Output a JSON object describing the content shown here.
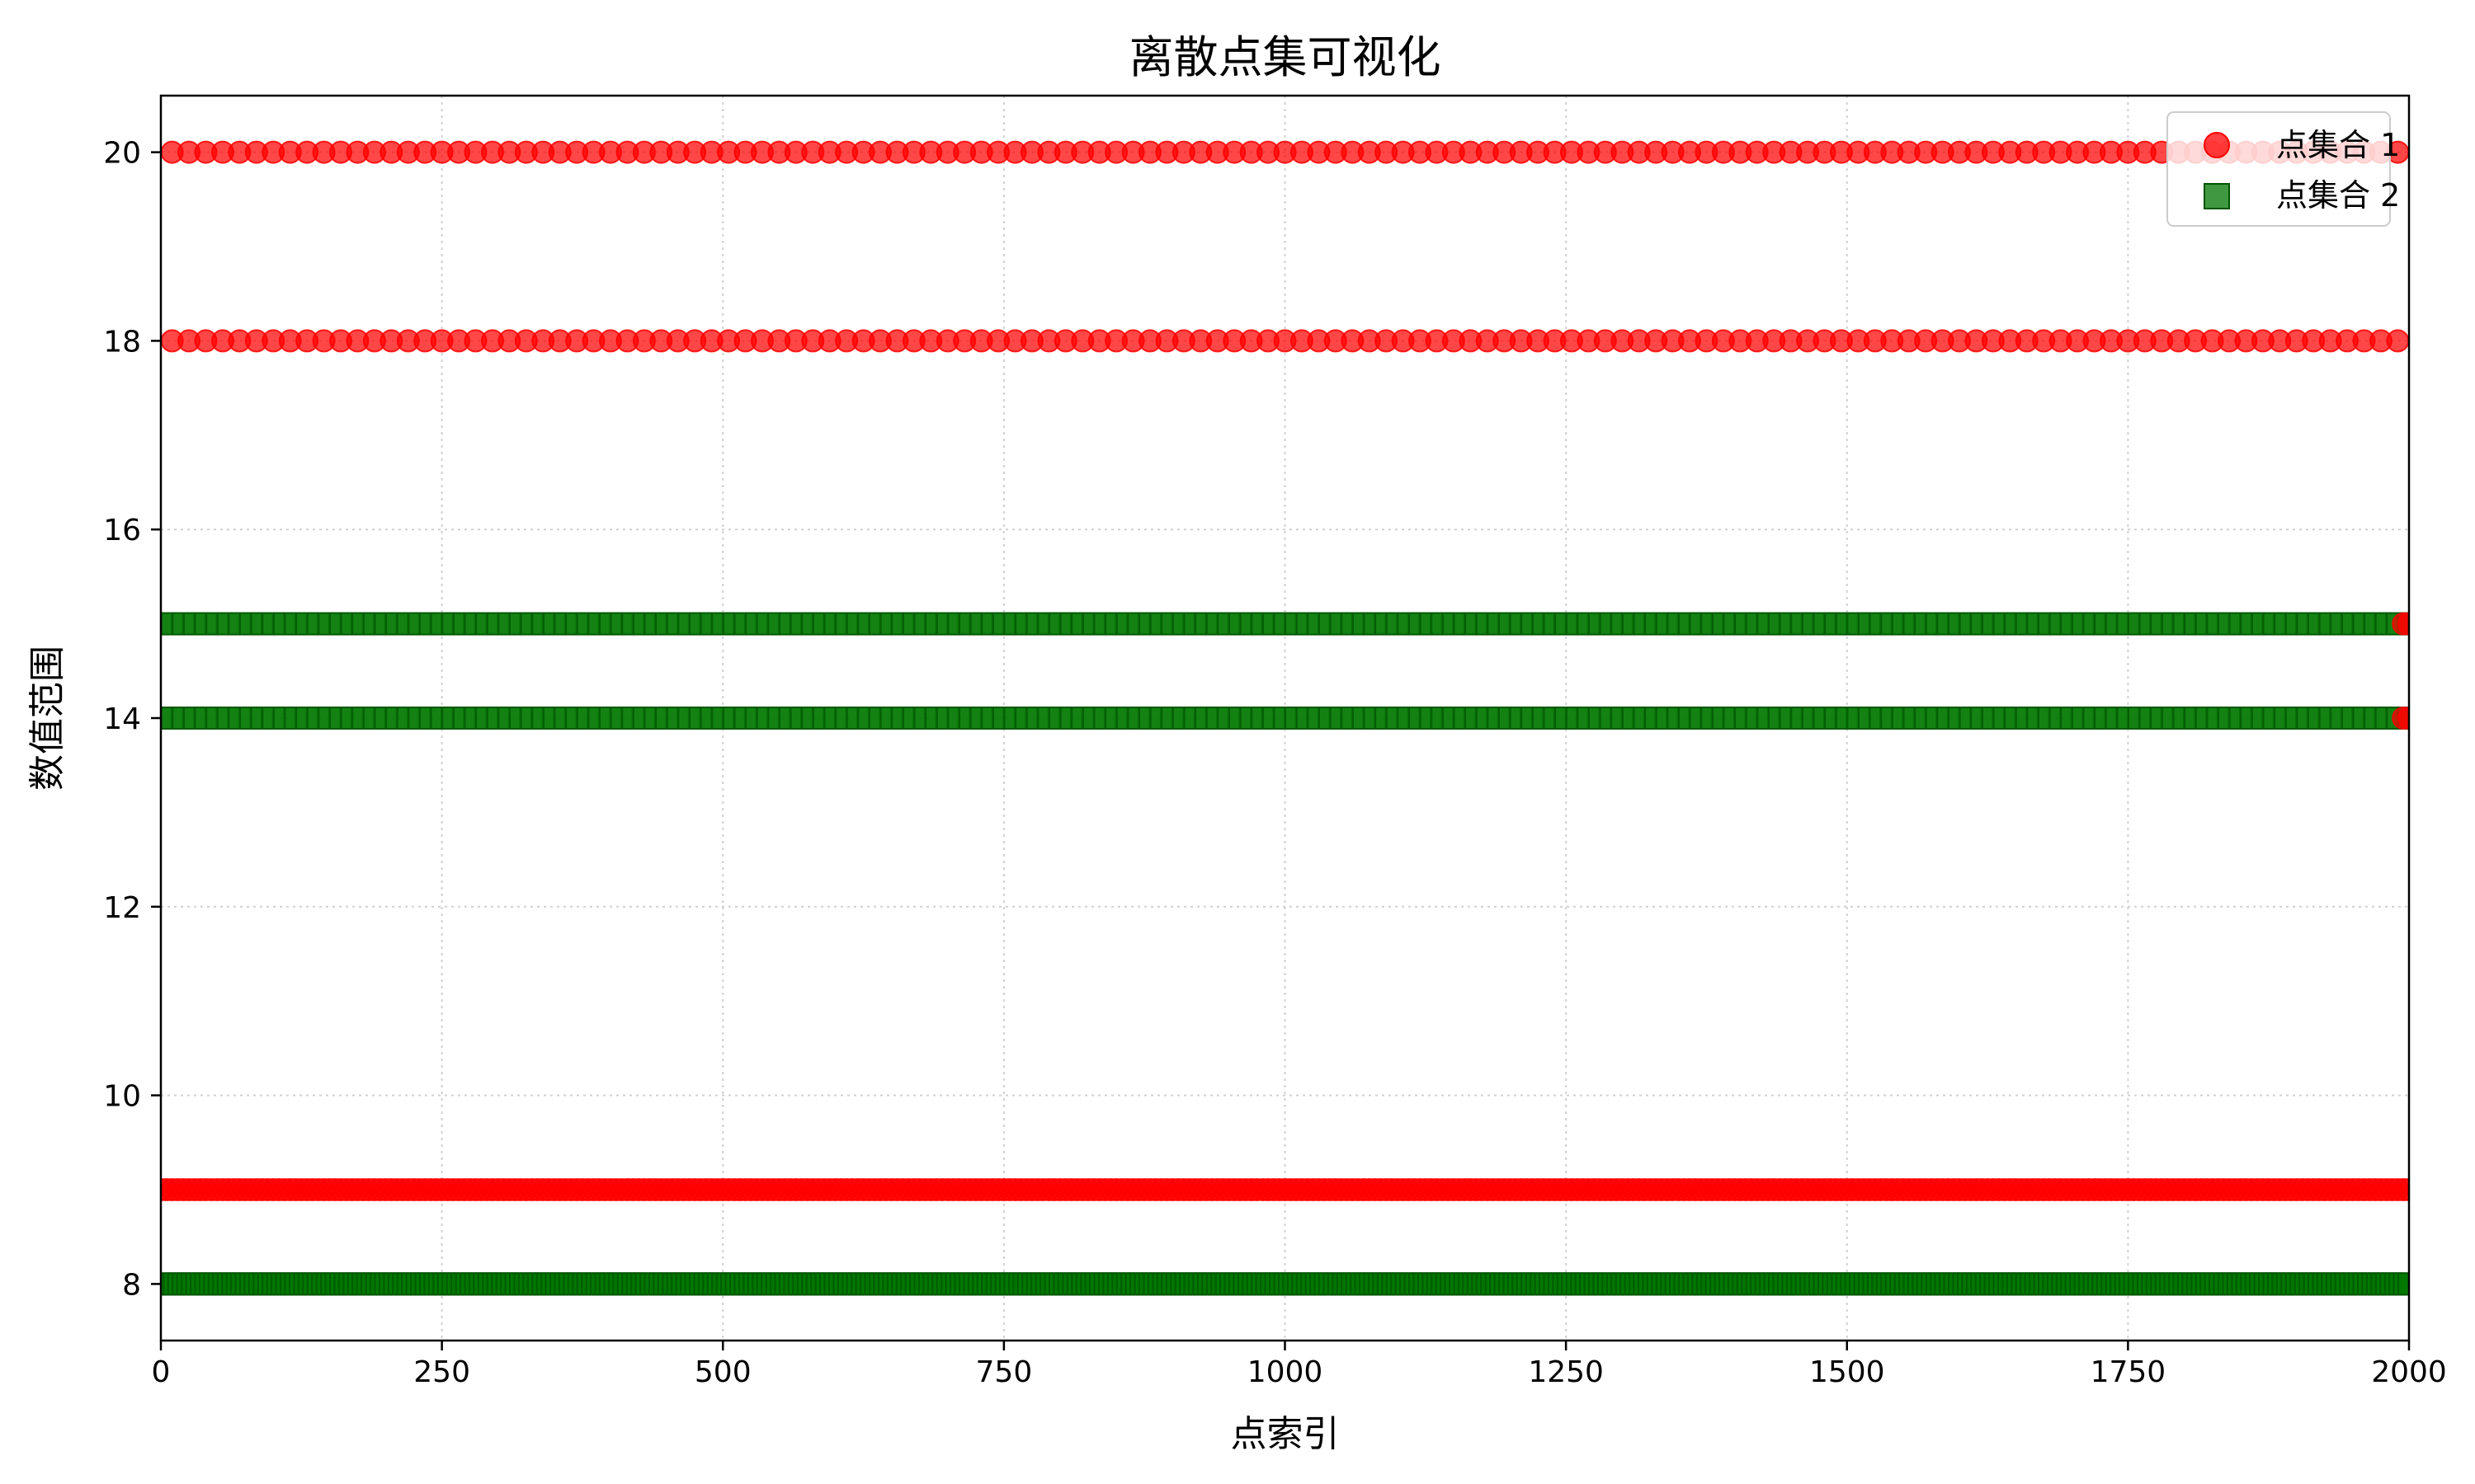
{
  "chart_data": {
    "type": "scatter",
    "title": "离散点集可视化",
    "xlabel": "点索引",
    "ylabel": "数值范围",
    "xlim": [
      0,
      2000
    ],
    "ylim": [
      7.4,
      20.6
    ],
    "xticks": [
      0,
      250,
      500,
      750,
      1000,
      1250,
      1500,
      1750,
      2000
    ],
    "yticks": [
      8,
      10,
      12,
      14,
      16,
      18,
      20
    ],
    "grid": true,
    "legend_position": "top-right",
    "series": [
      {
        "name": "点集合 1",
        "marker": "circle",
        "color": "#ff0000",
        "rows": [
          {
            "y": 20,
            "x_start": 10,
            "x_end": 2000,
            "x_step": 15
          },
          {
            "y": 18,
            "x_start": 10,
            "x_end": 2000,
            "x_step": 15
          },
          {
            "y": 15,
            "x_start": 1995,
            "x_end": 2000,
            "x_step": 5
          },
          {
            "y": 14,
            "x_start": 1995,
            "x_end": 2000,
            "x_step": 5
          },
          {
            "y": 9,
            "x_start": 0,
            "x_end": 2000,
            "x_step": 5
          }
        ]
      },
      {
        "name": "点集合 2",
        "marker": "square",
        "color": "#007700",
        "rows": [
          {
            "y": 15,
            "x_start": 0,
            "x_end": 2000,
            "x_step": 10
          },
          {
            "y": 14,
            "x_start": 0,
            "x_end": 2000,
            "x_step": 10
          },
          {
            "y": 8,
            "x_start": 0,
            "x_end": 2000,
            "x_step": 4
          }
        ]
      }
    ]
  }
}
